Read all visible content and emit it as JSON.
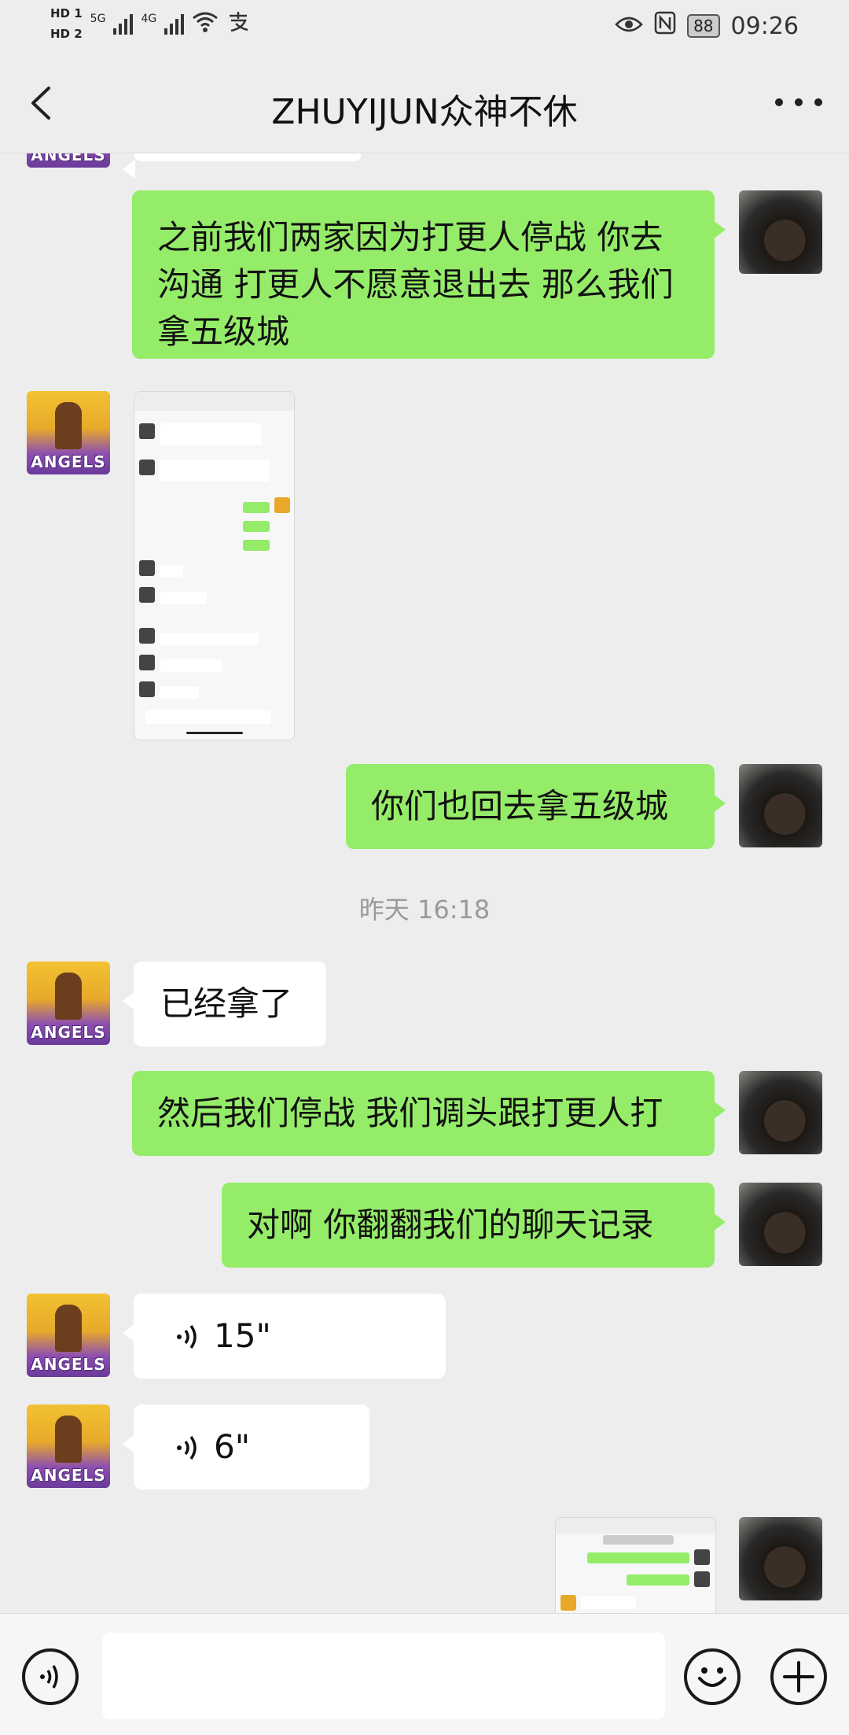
{
  "status_bar": {
    "hd1": "HD 1",
    "hd2": "HD 2",
    "net1": "5G",
    "net2": "4G",
    "battery": "88",
    "time": "09:26"
  },
  "nav": {
    "title": "ZHUYIJUN众神不休"
  },
  "messages": [
    {
      "sender": "self",
      "type": "text",
      "text": "之前我们两家因为打更人停战  你去沟通 打更人不愿意退出去 那么我们拿五级城"
    },
    {
      "sender": "other",
      "type": "image",
      "text": ""
    },
    {
      "sender": "self",
      "type": "text",
      "text": "你们也回去拿五级城"
    },
    {
      "type": "timestamp",
      "text": "昨天 16:18"
    },
    {
      "sender": "other",
      "type": "text",
      "text": "已经拿了"
    },
    {
      "sender": "self",
      "type": "text",
      "text": "然后我们停战 我们调头跟打更人打"
    },
    {
      "sender": "self",
      "type": "text",
      "text": "对啊  你翻翻我们的聊天记录"
    },
    {
      "sender": "other",
      "type": "voice",
      "text": "15\""
    },
    {
      "sender": "other",
      "type": "voice",
      "text": "6\""
    },
    {
      "sender": "self",
      "type": "image",
      "text": ""
    }
  ],
  "avatars": {
    "other_label": "ANGELS"
  },
  "input_bar": {
    "placeholder": ""
  },
  "colors": {
    "self_bubble": "#95ec69",
    "other_bubble": "#ffffff",
    "background": "#ededed"
  }
}
